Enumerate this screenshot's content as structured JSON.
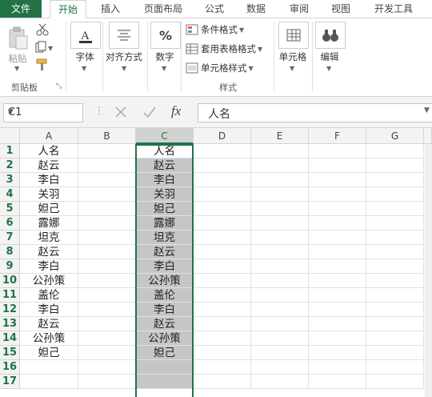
{
  "tabs": [
    "文件",
    "开始",
    "插入",
    "页面布局",
    "公式",
    "数据",
    "审阅",
    "视图",
    "开发工具"
  ],
  "ribbon": {
    "clipboard": {
      "paste": "粘贴",
      "group": "剪贴板"
    },
    "font": "字体",
    "align": "对齐方式",
    "number": "数字",
    "styles": {
      "cond": "条件格式",
      "table": "套用表格格式",
      "cell": "单元格样式",
      "group": "样式"
    },
    "cells": "单元格",
    "edit": "编辑",
    "number_icon_text": "%",
    "font_icon_text": "A"
  },
  "formula_bar": {
    "name_box": "C1",
    "fx_label": "fx",
    "content": "人名"
  },
  "columns": [
    "A",
    "B",
    "C",
    "D",
    "E",
    "F",
    "G"
  ],
  "rows": [
    "1",
    "2",
    "3",
    "4",
    "5",
    "6",
    "7",
    "8",
    "9",
    "10",
    "11",
    "12",
    "13",
    "14",
    "15",
    "16",
    "17"
  ],
  "col_a": [
    "人名",
    "赵云",
    "李白",
    "关羽",
    "妲己",
    "露娜",
    "坦克",
    "赵云",
    "李白",
    "公孙策",
    "盖伦",
    "李白",
    "赵云",
    "公孙策",
    "妲己",
    "",
    ""
  ],
  "col_c": [
    "人名",
    "赵云",
    "李白",
    "关羽",
    "妲己",
    "露娜",
    "坦克",
    "赵云",
    "李白",
    "公孙策",
    "盖伦",
    "李白",
    "赵云",
    "公孙策",
    "妲己",
    "",
    ""
  ],
  "colors": {
    "accent": "#217346",
    "selection": "#c6c6c6"
  }
}
